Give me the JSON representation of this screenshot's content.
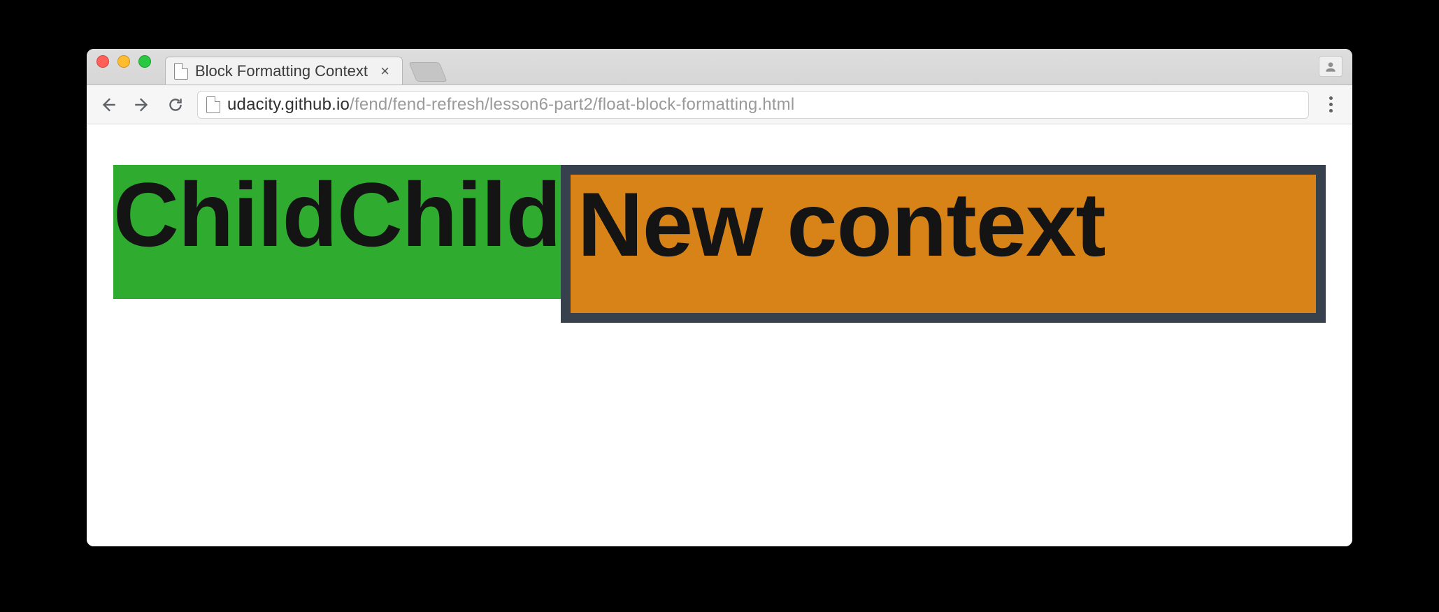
{
  "window": {
    "tab_title": "Block Formatting Context"
  },
  "address_bar": {
    "host": "udacity.github.io",
    "path": "/fend/fend-refresh/lesson6-part2/float-block-formatting.html"
  },
  "page": {
    "child_word_1": "Child",
    "child_word_2": "Child",
    "new_context_label": "New context"
  },
  "colors": {
    "green": "#2fac2f",
    "orange": "#d78318",
    "border_dark": "#36414d"
  }
}
